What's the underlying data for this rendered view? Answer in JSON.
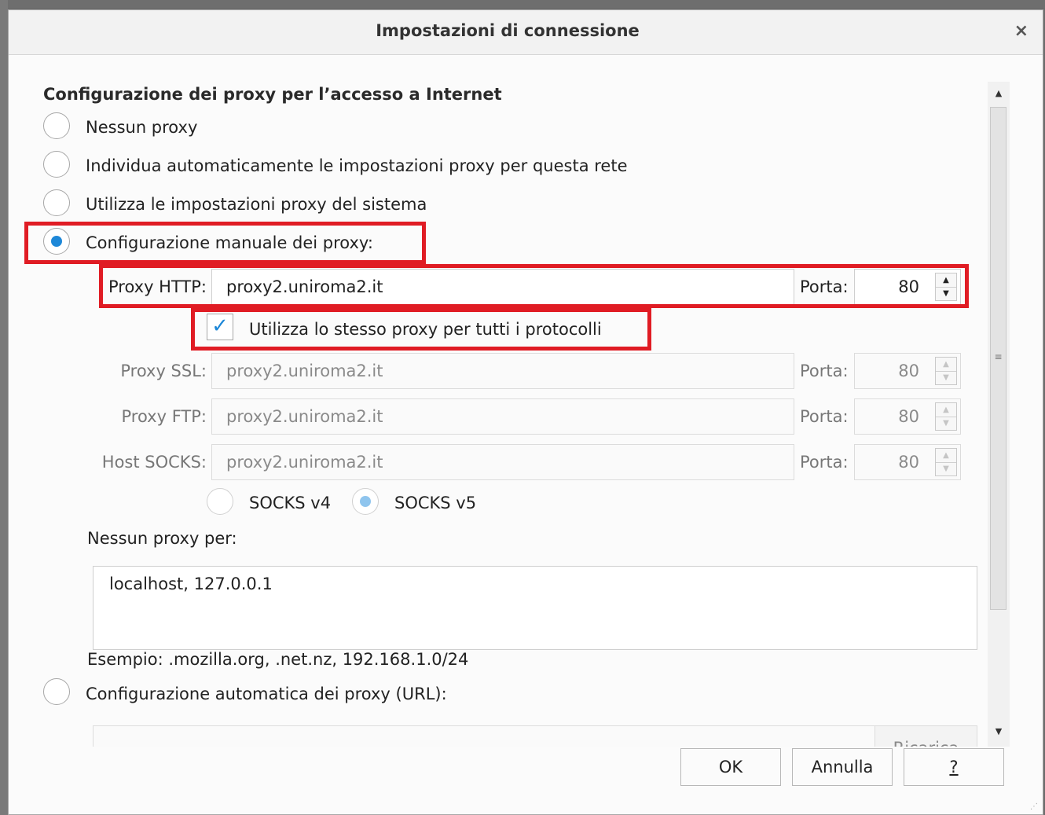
{
  "dialog": {
    "title": "Impostazioni di connessione",
    "close_label": "×"
  },
  "section_title": "Configurazione dei proxy per l’accesso a Internet",
  "options": {
    "no_proxy": "Nessun proxy",
    "auto_detect": "Individua automaticamente le impostazioni proxy per questa rete",
    "system": "Utilizza le impostazioni proxy del sistema",
    "manual": "Configurazione manuale dei proxy:",
    "auto_url": "Configurazione automatica dei proxy (URL):"
  },
  "selected_option": "manual",
  "http": {
    "label": "Proxy HTTP:",
    "value": "proxy2.uniroma2.it",
    "port_label": "Porta:",
    "port": "80"
  },
  "same_proxy": {
    "label": "Utilizza lo stesso proxy per tutti i protocolli",
    "checked": true
  },
  "ssl": {
    "label": "Proxy SSL:",
    "value": "proxy2.uniroma2.it",
    "port_label": "Porta:",
    "port": "80"
  },
  "ftp": {
    "label": "Proxy FTP:",
    "value": "proxy2.uniroma2.it",
    "port_label": "Porta:",
    "port": "80"
  },
  "socks": {
    "label": "Host SOCKS:",
    "value": "proxy2.uniroma2.it",
    "port_label": "Porta:",
    "port": "80"
  },
  "socks_versions": {
    "v4": "SOCKS v4",
    "v5": "SOCKS v5",
    "selected": "v5"
  },
  "no_proxy_for": {
    "label": "Nessun proxy per:",
    "value": "localhost, 127.0.0.1"
  },
  "example": "Esempio: .mozilla.org, .net.nz, 192.168.1.0/24",
  "reload_label": "Ricarica",
  "buttons": {
    "ok": "OK",
    "cancel": "Annulla",
    "help": "?"
  },
  "colors": {
    "accent": "#1e88d8",
    "highlight": "#e01c24"
  }
}
